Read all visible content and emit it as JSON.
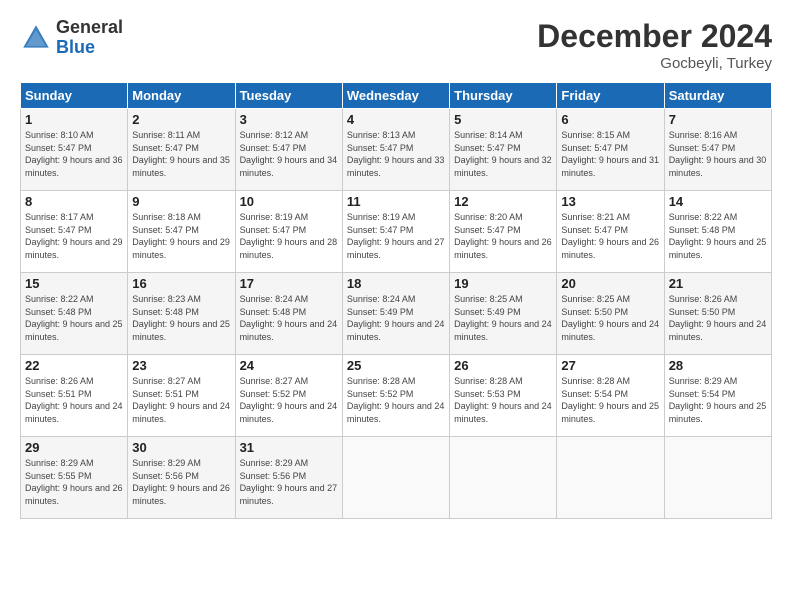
{
  "header": {
    "logo_general": "General",
    "logo_blue": "Blue",
    "month": "December 2024",
    "location": "Gocbeyli, Turkey"
  },
  "days_of_week": [
    "Sunday",
    "Monday",
    "Tuesday",
    "Wednesday",
    "Thursday",
    "Friday",
    "Saturday"
  ],
  "weeks": [
    [
      {
        "day": "1",
        "info": "Sunrise: 8:10 AM\nSunset: 5:47 PM\nDaylight: 9 hours\nand 36 minutes."
      },
      {
        "day": "2",
        "info": "Sunrise: 8:11 AM\nSunset: 5:47 PM\nDaylight: 9 hours\nand 35 minutes."
      },
      {
        "day": "3",
        "info": "Sunrise: 8:12 AM\nSunset: 5:47 PM\nDaylight: 9 hours\nand 34 minutes."
      },
      {
        "day": "4",
        "info": "Sunrise: 8:13 AM\nSunset: 5:47 PM\nDaylight: 9 hours\nand 33 minutes."
      },
      {
        "day": "5",
        "info": "Sunrise: 8:14 AM\nSunset: 5:47 PM\nDaylight: 9 hours\nand 32 minutes."
      },
      {
        "day": "6",
        "info": "Sunrise: 8:15 AM\nSunset: 5:47 PM\nDaylight: 9 hours\nand 31 minutes."
      },
      {
        "day": "7",
        "info": "Sunrise: 8:16 AM\nSunset: 5:47 PM\nDaylight: 9 hours\nand 30 minutes."
      }
    ],
    [
      {
        "day": "8",
        "info": "Sunrise: 8:17 AM\nSunset: 5:47 PM\nDaylight: 9 hours\nand 29 minutes."
      },
      {
        "day": "9",
        "info": "Sunrise: 8:18 AM\nSunset: 5:47 PM\nDaylight: 9 hours\nand 29 minutes."
      },
      {
        "day": "10",
        "info": "Sunrise: 8:19 AM\nSunset: 5:47 PM\nDaylight: 9 hours\nand 28 minutes."
      },
      {
        "day": "11",
        "info": "Sunrise: 8:19 AM\nSunset: 5:47 PM\nDaylight: 9 hours\nand 27 minutes."
      },
      {
        "day": "12",
        "info": "Sunrise: 8:20 AM\nSunset: 5:47 PM\nDaylight: 9 hours\nand 26 minutes."
      },
      {
        "day": "13",
        "info": "Sunrise: 8:21 AM\nSunset: 5:47 PM\nDaylight: 9 hours\nand 26 minutes."
      },
      {
        "day": "14",
        "info": "Sunrise: 8:22 AM\nSunset: 5:48 PM\nDaylight: 9 hours\nand 25 minutes."
      }
    ],
    [
      {
        "day": "15",
        "info": "Sunrise: 8:22 AM\nSunset: 5:48 PM\nDaylight: 9 hours\nand 25 minutes."
      },
      {
        "day": "16",
        "info": "Sunrise: 8:23 AM\nSunset: 5:48 PM\nDaylight: 9 hours\nand 25 minutes."
      },
      {
        "day": "17",
        "info": "Sunrise: 8:24 AM\nSunset: 5:48 PM\nDaylight: 9 hours\nand 24 minutes."
      },
      {
        "day": "18",
        "info": "Sunrise: 8:24 AM\nSunset: 5:49 PM\nDaylight: 9 hours\nand 24 minutes."
      },
      {
        "day": "19",
        "info": "Sunrise: 8:25 AM\nSunset: 5:49 PM\nDaylight: 9 hours\nand 24 minutes."
      },
      {
        "day": "20",
        "info": "Sunrise: 8:25 AM\nSunset: 5:50 PM\nDaylight: 9 hours\nand 24 minutes."
      },
      {
        "day": "21",
        "info": "Sunrise: 8:26 AM\nSunset: 5:50 PM\nDaylight: 9 hours\nand 24 minutes."
      }
    ],
    [
      {
        "day": "22",
        "info": "Sunrise: 8:26 AM\nSunset: 5:51 PM\nDaylight: 9 hours\nand 24 minutes."
      },
      {
        "day": "23",
        "info": "Sunrise: 8:27 AM\nSunset: 5:51 PM\nDaylight: 9 hours\nand 24 minutes."
      },
      {
        "day": "24",
        "info": "Sunrise: 8:27 AM\nSunset: 5:52 PM\nDaylight: 9 hours\nand 24 minutes."
      },
      {
        "day": "25",
        "info": "Sunrise: 8:28 AM\nSunset: 5:52 PM\nDaylight: 9 hours\nand 24 minutes."
      },
      {
        "day": "26",
        "info": "Sunrise: 8:28 AM\nSunset: 5:53 PM\nDaylight: 9 hours\nand 24 minutes."
      },
      {
        "day": "27",
        "info": "Sunrise: 8:28 AM\nSunset: 5:54 PM\nDaylight: 9 hours\nand 25 minutes."
      },
      {
        "day": "28",
        "info": "Sunrise: 8:29 AM\nSunset: 5:54 PM\nDaylight: 9 hours\nand 25 minutes."
      }
    ],
    [
      {
        "day": "29",
        "info": "Sunrise: 8:29 AM\nSunset: 5:55 PM\nDaylight: 9 hours\nand 26 minutes."
      },
      {
        "day": "30",
        "info": "Sunrise: 8:29 AM\nSunset: 5:56 PM\nDaylight: 9 hours\nand 26 minutes."
      },
      {
        "day": "31",
        "info": "Sunrise: 8:29 AM\nSunset: 5:56 PM\nDaylight: 9 hours\nand 27 minutes."
      },
      {
        "day": "",
        "info": ""
      },
      {
        "day": "",
        "info": ""
      },
      {
        "day": "",
        "info": ""
      },
      {
        "day": "",
        "info": ""
      }
    ]
  ]
}
